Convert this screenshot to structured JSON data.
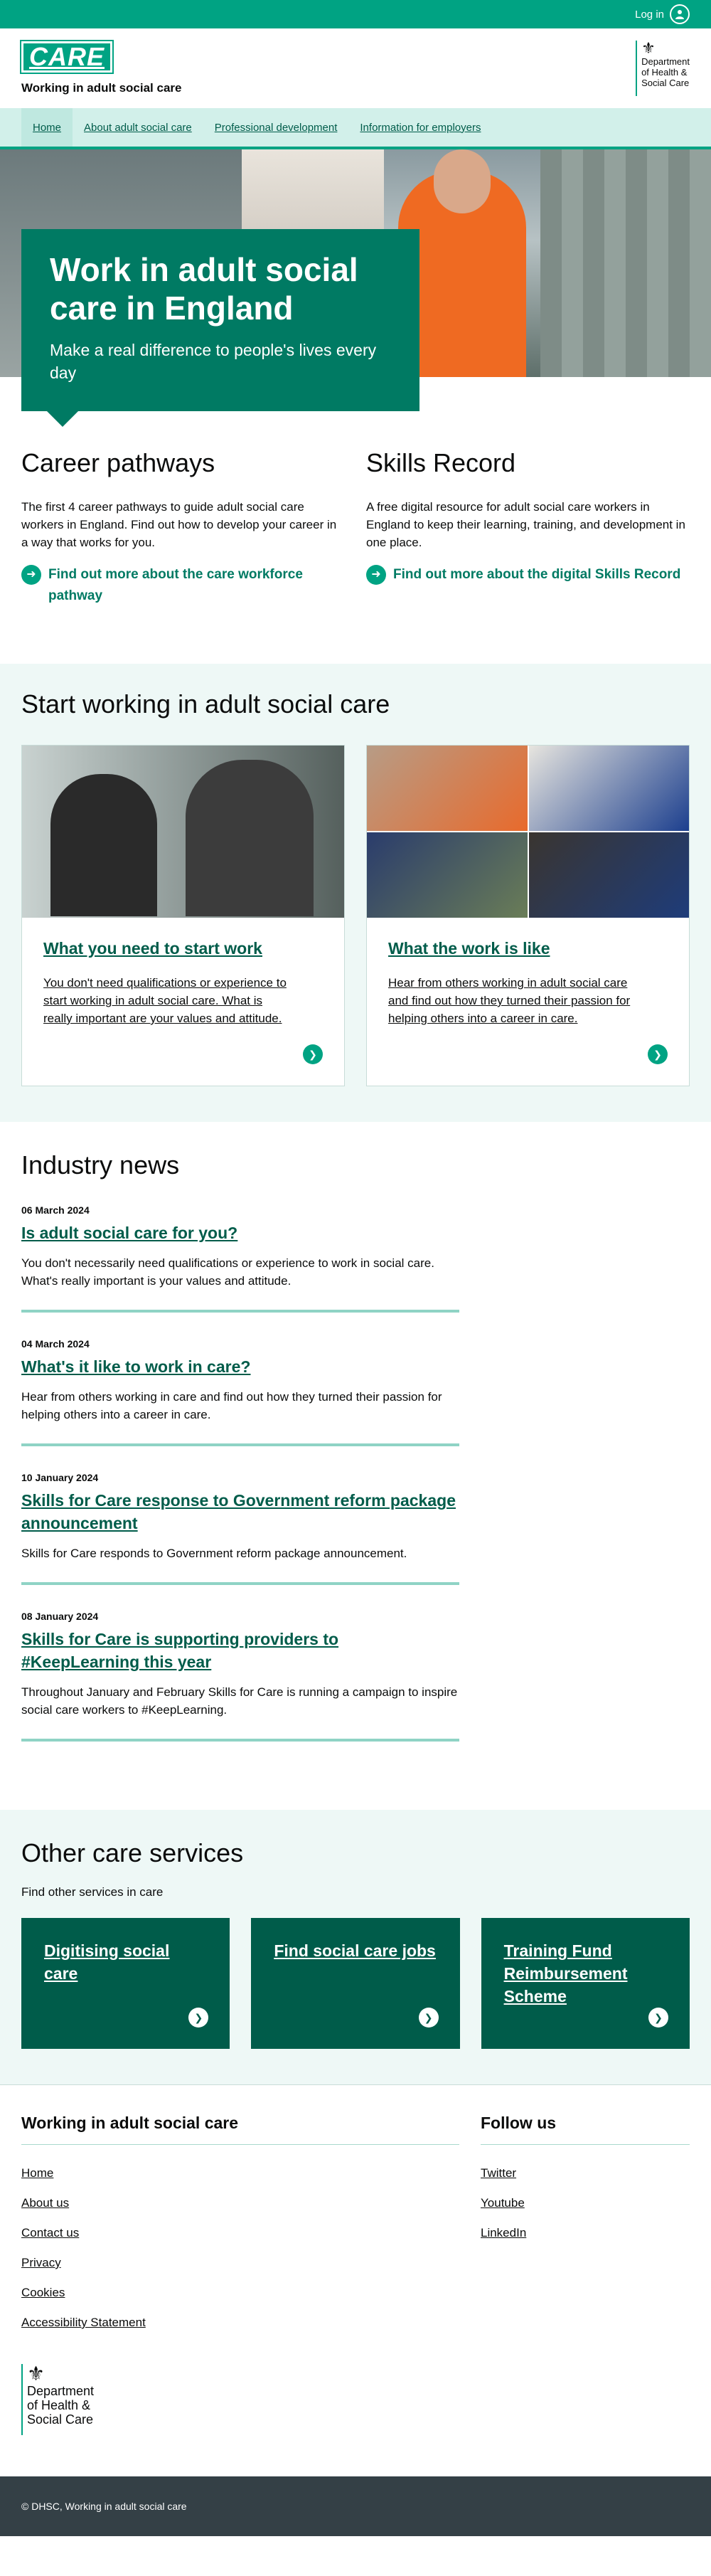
{
  "topbar": {
    "login_label": "Log in",
    "login_icon": "user-circle-icon"
  },
  "header": {
    "logo_text": "CARE",
    "site_name": "Working in adult social care",
    "dept_lines": [
      "Department",
      "of Health &",
      "Social Care"
    ]
  },
  "nav": {
    "items": [
      {
        "label": "Home"
      },
      {
        "label": "About adult social care"
      },
      {
        "label": "Professional development"
      },
      {
        "label": "Information for employers"
      }
    ]
  },
  "hero": {
    "title": "Work in adult social care in England",
    "subtitle": "Make a real difference to people's lives every day"
  },
  "pathways": [
    {
      "title": "Career pathways",
      "text": "The first 4 career pathways to guide adult social care workers in England. Find out how to develop your career in a way that works for you.",
      "link": "Find out more about the care workforce pathway"
    },
    {
      "title": "Skills Record",
      "text": "A free digital resource for adult social care workers in England to keep their learning, training, and development in one place.",
      "link": "Find out more about the digital Skills Record"
    }
  ],
  "start": {
    "title": "Start working in adult social care",
    "cards": [
      {
        "title": "What you need to start work",
        "text": "You don't need qualifications or experience to start working in adult social care. What is really important are your values and attitude."
      },
      {
        "title": "What the work is like",
        "text": "Hear from others working in adult social care and find out how they turned their passion for helping others into a career in care."
      }
    ]
  },
  "news": {
    "title": "Industry news",
    "items": [
      {
        "date": "06 March 2024",
        "title": "Is adult social care for you?",
        "text": "You don't necessarily need qualifications or experience to work in social care. What's really important is your values and attitude."
      },
      {
        "date": "04 March 2024",
        "title": "What's it like to work in care?",
        "text": "Hear from others working in care and find out how they turned their passion for helping others into a career in care."
      },
      {
        "date": "10 January 2024",
        "title": "Skills for Care response to Government reform package announcement",
        "text": "Skills for Care responds to Government reform package announcement."
      },
      {
        "date": "08 January 2024",
        "title": "Skills for Care is supporting providers to #KeepLearning this year",
        "text": "Throughout January and February Skills for Care is running a campaign to inspire social care workers to #KeepLearning."
      }
    ]
  },
  "other": {
    "title": "Other care services",
    "intro": "Find other services in care",
    "cards": [
      {
        "title": "Digitising social care"
      },
      {
        "title": "Find social care jobs"
      },
      {
        "title": "Training Fund Reimbursement Scheme"
      }
    ]
  },
  "footer": {
    "main_title": "Working in adult social care",
    "links": [
      "Home",
      "About us",
      "Contact us",
      "Privacy",
      "Cookies",
      "Accessibility Statement"
    ],
    "follow_title": "Follow us",
    "social": [
      "Twitter",
      "Youtube",
      "LinkedIn"
    ],
    "dept_lines": [
      "Department",
      "of Health &",
      "Social Care"
    ],
    "copyright": "© DHSC, Working in adult social care"
  },
  "colors": {
    "brand": "#00a383",
    "dark": "#007a63",
    "darker": "#005c4a",
    "tint": "#eef8f6",
    "footer_bar": "#344046"
  }
}
